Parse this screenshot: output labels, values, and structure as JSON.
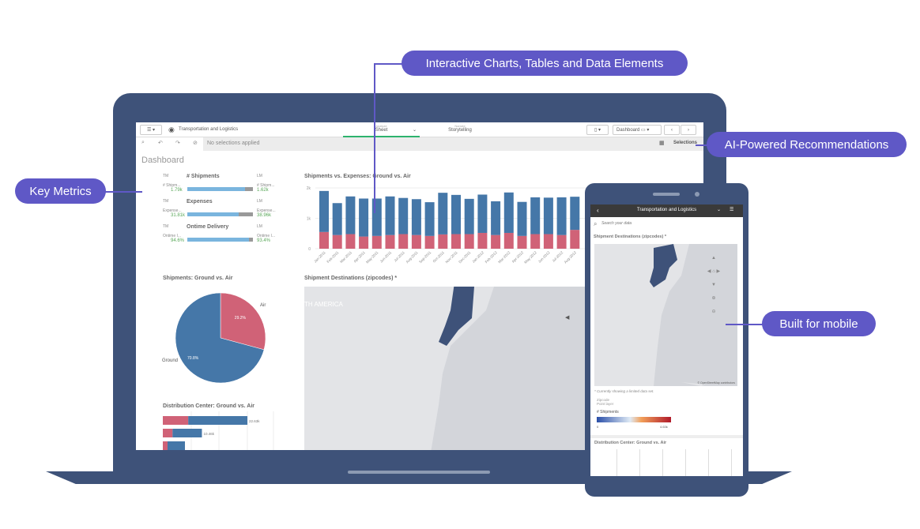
{
  "callouts": {
    "charts": "Interactive Charts, Tables and Data Elements",
    "ai": "AI-Powered Recommendations",
    "kpi": "Key Metrics",
    "mobile": "Built for mobile"
  },
  "app": {
    "title": "Transportation and Logistics",
    "analyze_label": "Analyze",
    "analyze_value": "Sheet",
    "narrate_label": "Narrate",
    "narrate_value": "Storytelling",
    "sheet_button": "Dashboard",
    "no_selections": "No selections applied",
    "selections": "Selections",
    "sheet_title": "Dashboard"
  },
  "kpis": [
    {
      "title": "# Shipments",
      "tm": "TM",
      "lm": "LM",
      "tm_label": "# Shipm...",
      "tm_value": "1.79k",
      "lm_label": "# Shipm...",
      "lm_value": "1.62k",
      "fill": 0.88
    },
    {
      "title": "Expenses",
      "tm": "TM",
      "lm": "LM",
      "tm_label": "Expense...",
      "tm_value": "31.81k",
      "lm_label": "Expense...",
      "lm_value": "38.96k",
      "fill": 0.78
    },
    {
      "title": "Ontime Delivery",
      "tm": "TM",
      "lm": "LM",
      "tm_label": "Ontime I...",
      "tm_value": "94.6%",
      "lm_label": "Ontime I...",
      "lm_value": "93.4%",
      "fill": 0.94
    }
  ],
  "colors": {
    "ground": "#4577a8",
    "air": "#d06277",
    "accent": "#5f58c6",
    "frame": "#3e5279"
  },
  "chart_data": [
    {
      "type": "bar",
      "stacked": true,
      "title": "Shipments vs. Expenses: Ground vs. Air",
      "ytick_labels": [
        "0",
        "1k",
        "2k"
      ],
      "ylim": [
        0,
        2000
      ],
      "categories": [
        "Jan-2011",
        "Feb-2011",
        "Mar-2011",
        "Apr-2011",
        "May-2011",
        "Jun-2011",
        "Jul-2011",
        "Aug-2011",
        "Sep-2011",
        "Oct-2011",
        "Nov-2011",
        "Dec-2011",
        "Jan-2012",
        "Feb-2012",
        "Mar-2012",
        "Apr-2012",
        "May-2012",
        "Jun-2012",
        "Jul-2012",
        "Aug-2012"
      ],
      "series": [
        {
          "values": [
            550,
            450,
            480,
            400,
            420,
            450,
            480,
            450,
            420,
            470,
            480,
            480,
            520,
            450,
            520,
            420,
            480,
            480,
            450,
            620
          ]
        },
        {
          "values": [
            1350,
            1050,
            1240,
            1250,
            1230,
            1270,
            1190,
            1180,
            1110,
            1370,
            1290,
            1160,
            1260,
            1110,
            1330,
            1120,
            1210,
            1200,
            1240,
            1090
          ]
        }
      ]
    },
    {
      "type": "pie",
      "title": "Shipments: Ground vs. Air",
      "slices": [
        {
          "label": "Air",
          "value": 29.2,
          "text": "29.2%"
        },
        {
          "label": "Ground",
          "value": 70.8,
          "text": "70.8%"
        }
      ]
    },
    {
      "type": "bar",
      "orientation": "horizontal",
      "stacked": true,
      "title": "Distribution Center: Ground vs. Air",
      "bars": [
        {
          "air": 6800,
          "ground": 15830,
          "label": "22.63k"
        },
        {
          "air": 2600,
          "ground": 7860,
          "label": "10.46k"
        }
      ]
    }
  ],
  "map": {
    "title": "Shipment Destinations (zipcodes) *",
    "region_label": "TH AMERICA"
  },
  "mobile": {
    "title": "Transportation and Logistics",
    "search_placeholder": "Search your data",
    "map_title": "Shipment Destinations (zipcodes) *",
    "note": "* Currently showing a limited data set.",
    "layer1": "Zipcode",
    "layer2": "Point layer",
    "legend_title": "# Shipments",
    "legend_min": "0",
    "legend_max": "4.63k",
    "attribution": "© OpenStreetMap contributors",
    "dc_title": "Distribution Center: Ground vs. Air"
  }
}
